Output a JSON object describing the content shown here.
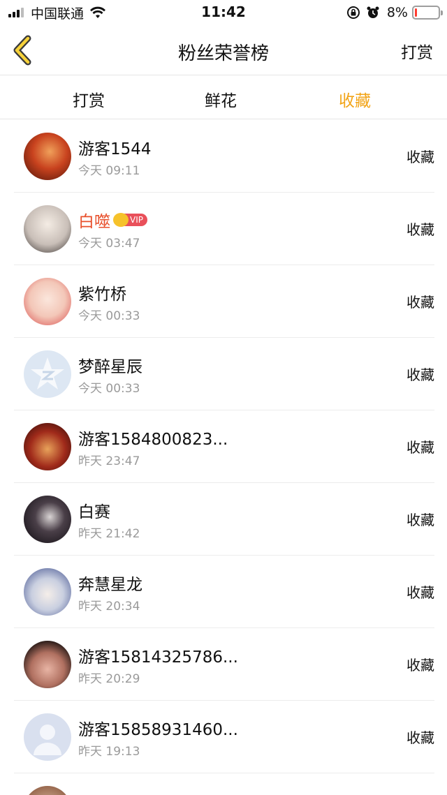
{
  "status_bar": {
    "carrier": "中国联通",
    "time": "11:42",
    "battery_percent": "8%",
    "battery_level": 0.08,
    "battery_color": "#ff3b30",
    "icons": [
      "signal-icon",
      "wifi-icon",
      "rotation-lock-icon",
      "alarm-icon",
      "battery-icon"
    ]
  },
  "nav": {
    "back_icon": "chevron-left-icon",
    "title": "粉丝荣誉榜",
    "right_action": "打赏"
  },
  "tabs": [
    {
      "label": "打赏",
      "active": false
    },
    {
      "label": "鲜花",
      "active": false
    },
    {
      "label": "收藏",
      "active": true
    }
  ],
  "accent_color": "#f2a417",
  "list": [
    {
      "name": "游客1544",
      "time": "今天 09:11",
      "action": "收藏",
      "vip": false
    },
    {
      "name": "白噬",
      "time": "今天 03:47",
      "action": "收藏",
      "vip": true,
      "vip_label": "VIP"
    },
    {
      "name": "紫竹桥",
      "time": "今天 00:33",
      "action": "收藏",
      "vip": false
    },
    {
      "name": "梦醉星辰",
      "time": "今天 00:33",
      "action": "收藏",
      "vip": false
    },
    {
      "name": "游客1584800823...",
      "time": "昨天 23:47",
      "action": "收藏",
      "vip": false
    },
    {
      "name": "白赛",
      "time": "昨天 21:42",
      "action": "收藏",
      "vip": false
    },
    {
      "name": "奔慧星龙",
      "time": "昨天 20:34",
      "action": "收藏",
      "vip": false
    },
    {
      "name": "游客15814325786...",
      "time": "昨天 20:29",
      "action": "收藏",
      "vip": false
    },
    {
      "name": "游客15858931460...",
      "time": "昨天 19:13",
      "action": "收藏",
      "vip": false
    }
  ]
}
